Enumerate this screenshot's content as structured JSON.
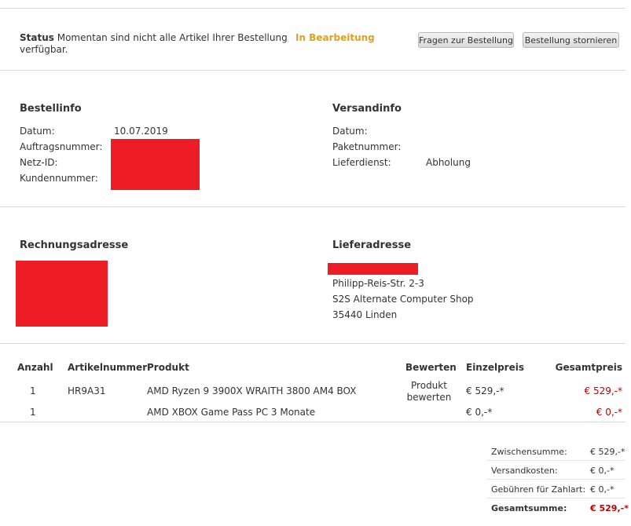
{
  "status": {
    "label": "Status",
    "text_line1": "Momentan sind nicht alle Artikel Ihrer Bestellung",
    "text_line2": "verfügbar.",
    "value": "In Bearbeitung",
    "value_color": "#e0a21c"
  },
  "buttons": {
    "questions": "Fragen zur Bestellung",
    "cancel": "Bestellung stornieren"
  },
  "order_info": {
    "heading": "Bestellinfo",
    "date_label": "Datum:",
    "date_value": "10.07.2019",
    "order_number_label": "Auftragsnummer:",
    "net_id_label": "Netz-ID:",
    "customer_number_label": "Kundennummer:"
  },
  "shipping_info": {
    "heading": "Versandinfo",
    "date_label": "Datum:",
    "package_number_label": "Paketnummer:",
    "carrier_label": "Lieferdienst:",
    "carrier_value": "Abholung"
  },
  "billing_address": {
    "heading": "Rechnungsadresse"
  },
  "delivery_address": {
    "heading": "Lieferadresse",
    "street": "Philipp-Reis-Str. 2-3",
    "company": "S2S Alternate Computer Shop",
    "city": "35440 Linden"
  },
  "table": {
    "headers": {
      "qty": "Anzahl",
      "article_number": "Artikelnummer",
      "product": "Produkt",
      "rate": "Bewerten",
      "unit_price": "Einzelpreis",
      "total_price": "Gesamtpreis"
    },
    "rows": [
      {
        "qty": "1",
        "article_number": "HR9A31",
        "product": "AMD Ryzen 9 3900X WRAITH 3800 AM4 BOX",
        "rate_line1": "Produkt",
        "rate_line2": "bewerten",
        "unit_price": "€ 529,-*",
        "total_price": "€ 529,-*"
      },
      {
        "qty": "1",
        "article_number": "",
        "product": "AMD XBOX Game Pass PC 3 Monate",
        "unit_price": "€ 0,-*",
        "total_price": "€ 0,-*"
      }
    ]
  },
  "summary": {
    "subtotal_label": "Zwischensumme:",
    "subtotal_value": "€ 529,-*",
    "shipping_label": "Versandkosten:",
    "shipping_value": "€ 0,-*",
    "fees_label": "Gebühren für Zahlart:",
    "fees_value": "€ 0,-*",
    "total_label": "Gesamtsumme:",
    "total_value": "€ 529,-*"
  },
  "colors": {
    "redaction": "#ee1c25",
    "price_red": "#c00000"
  }
}
